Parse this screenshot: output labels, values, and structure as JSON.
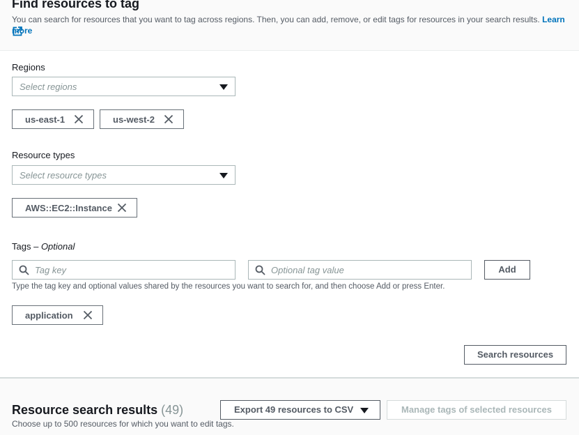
{
  "find": {
    "title": "Find resources to tag",
    "description": "You can search for resources that you want to tag across regions. Then, you can add, remove, or edit tags for resources in your search results.",
    "learn_more": "Learn more"
  },
  "regions": {
    "label": "Regions",
    "placeholder": "Select regions",
    "tokens": [
      "us-east-1",
      "us-west-2"
    ]
  },
  "resource_types": {
    "label": "Resource types",
    "placeholder": "Select resource types",
    "tokens": [
      "AWS::EC2::Instance"
    ]
  },
  "tags": {
    "label": "Tags –",
    "optional": "Optional",
    "key_placeholder": "Tag key",
    "value_placeholder": "Optional tag value",
    "add_label": "Add",
    "help": "Type the tag key and optional values shared by the resources you want to search for, and then choose Add or press Enter.",
    "tokens": [
      "application"
    ]
  },
  "search_button": "Search resources",
  "results": {
    "title": "Resource search results",
    "count": "(49)",
    "description": "Choose up to 500 resources for which you want to edit tags.",
    "export_label": "Export 49 resources to CSV",
    "manage_label": "Manage tags of selected resources"
  },
  "colors": {
    "link": "#0073bb",
    "border": "#aab7b8",
    "text_secondary": "#545b64"
  },
  "icons": {
    "external": "external-link-icon",
    "remove": "close-icon",
    "search": "search-icon",
    "dropdown": "caret-down-icon"
  }
}
